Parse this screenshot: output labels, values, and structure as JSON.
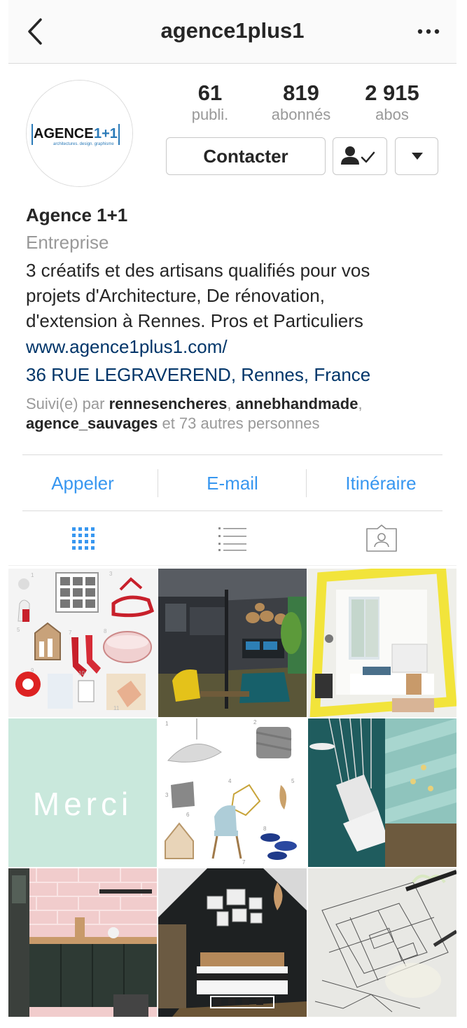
{
  "header": {
    "username": "agence1plus1"
  },
  "avatar": {
    "logo_text": "AGENCE 1+1",
    "logo_subtext": "architectures. design. graphisme"
  },
  "stats": [
    {
      "value": "61",
      "label": "publi."
    },
    {
      "value": "819",
      "label": "abonnés"
    },
    {
      "value": "2 915",
      "label": "abos"
    }
  ],
  "buttons": {
    "contact": "Contacter"
  },
  "profile": {
    "name": "Agence 1+1",
    "category": "Entreprise",
    "bio_lines": [
      "3 créatifs et des artisans qualifiés pour vos",
      "projets d'Architecture, De rénovation,",
      "d'extension à Rennes. Pros et Particuliers"
    ],
    "website": "www.agence1plus1.com/",
    "address": "36 RUE LEGRAVEREND, Rennes, France"
  },
  "followed_by": {
    "prefix": "Suivi(e) par",
    "user1": "rennesencheres",
    "sep1": ",",
    "user2": "annebhandmade",
    "sep2": ",",
    "user3": "agence_sauvages",
    "suffix": "et 73 autres personnes"
  },
  "actions": [
    "Appeler",
    "E-mail",
    "Itinéraire"
  ],
  "tabs": [
    {
      "icon": "grid-icon",
      "active": true
    },
    {
      "icon": "list-icon",
      "active": false
    },
    {
      "icon": "tagged-icon",
      "active": false
    }
  ],
  "posts": [
    {
      "subject": "moodboard-christmas"
    },
    {
      "subject": "office-interior-render"
    },
    {
      "subject": "kids-room-yellow-frame"
    },
    {
      "subject": "merci-card",
      "text": "Merci"
    },
    {
      "subject": "moodboard-furniture"
    },
    {
      "subject": "teal-staircase"
    },
    {
      "subject": "pink-brick-kitchen"
    },
    {
      "subject": "dark-bedroom-frames"
    },
    {
      "subject": "architecture-sketch"
    }
  ],
  "colors": {
    "link": "#003569",
    "action": "#3897f0",
    "muted": "#999999",
    "merci_bg": "#c9e8dc"
  }
}
